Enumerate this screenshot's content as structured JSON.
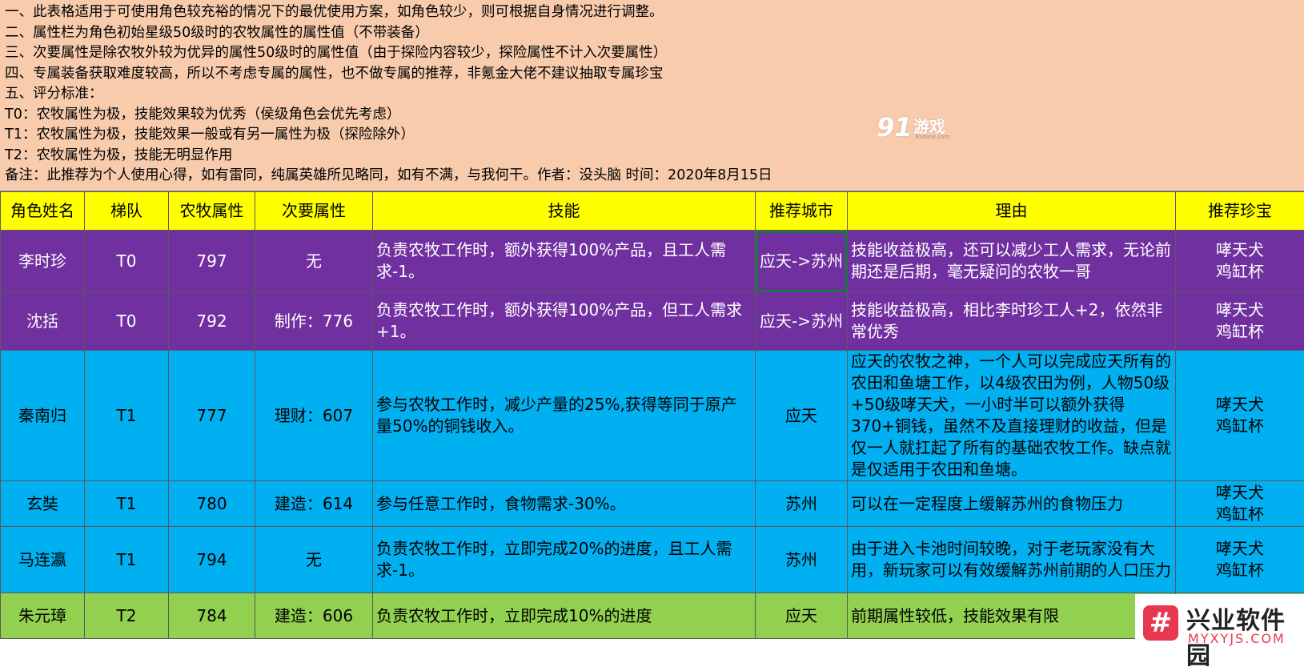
{
  "notes": [
    "一、此表格适用于可使用角色较充裕的情况下的最优使用方案，如角色较少，则可根据自身情况进行调整。",
    "二、属性栏为角色初始星级50级时的农牧属性的属性值（不带装备）",
    "三、次要属性是除农牧外较为优异的属性50级时的属性值（由于探险内容较少，探险属性不计入次要属性）",
    "四、专属装备获取难度较高，所以不考虑专属的属性，也不做专属的推荐，非氪金大佬不建议抽取专属珍宝",
    "五、评分标准：",
    "T0：农牧属性为极，技能效果较为优秀（侯级角色会优先考虑）",
    "T1：农牧属性为极，技能效果一般或有另一属性为极（探险除外）",
    "T2：农牧属性为极，技能无明显作用",
    "备注：此推荐为个人使用心得，如有雷同，纯属英雄所见略同，如有不满，与我何干。作者：没头脑 时间：2020年8月15日"
  ],
  "watermark_91": {
    "num": "91",
    "text": "游戏",
    "url": "91danji.com"
  },
  "headers": [
    "角色姓名",
    "梯队",
    "农牧属性",
    "次要属性",
    "技能",
    "推荐城市",
    "理由",
    "推荐珍宝"
  ],
  "rows": [
    {
      "name": "李时珍",
      "tier": "T0",
      "farm": "797",
      "secondary": "无",
      "skill": "负责农牧工作时，额外获得100%产品，且工人需求-1。",
      "city": "应天->苏州",
      "reason": "技能收益极高，还可以减少工人需求，无论前期还是后期，毫无疑问的农牧一哥",
      "treasure": "哮天犬\n鸡缸杯",
      "color": "#7030a0"
    },
    {
      "name": "沈括",
      "tier": "T0",
      "farm": "792",
      "secondary": "制作：776",
      "skill": "负责农牧工作时，额外获得100%产品，但工人需求+1。",
      "city": "应天->苏州",
      "reason": "技能收益极高，相比李时珍工人+2，依然非常优秀",
      "treasure": "哮天犬\n鸡缸杯",
      "color": "#7030a0"
    },
    {
      "name": "秦南归",
      "tier": "T1",
      "farm": "777",
      "secondary": "理财：607",
      "skill": "参与农牧工作时，减少产量的25%,获得等同于原产量50%的铜钱收入。",
      "city": "应天",
      "reason": "应天的农牧之神，一个人可以完成应天所有的农田和鱼塘工作，以4级农田为例，人物50级+50级哮天犬，一小时半可以额外获得370+铜钱，虽然不及直接理财的收益，但是仅一人就扛起了所有的基础农牧工作。缺点就是仅适用于农田和鱼塘。",
      "treasure": "哮天犬\n鸡缸杯",
      "color": "#00b0f0"
    },
    {
      "name": "玄奘",
      "tier": "T1",
      "farm": "780",
      "secondary": "建造：614",
      "skill": "参与任意工作时，食物需求-30%。",
      "city": "苏州",
      "reason": "可以在一定程度上缓解苏州的食物压力",
      "treasure": "哮天犬\n鸡缸杯",
      "color": "#00b0f0"
    },
    {
      "name": "马连瀛",
      "tier": "T1",
      "farm": "794",
      "secondary": "无",
      "skill": "负责农牧工作时，立即完成20%的进度，且工人需求-1。",
      "city": "苏州",
      "reason": "由于进入卡池时间较晚，对于老玩家没有大用，新玩家可以有效缓解苏州前期的人口压力",
      "treasure": "哮天犬\n鸡缸杯",
      "color": "#00b0f0"
    },
    {
      "name": "朱元璋",
      "tier": "T2",
      "farm": "784",
      "secondary": "建造：606",
      "skill": "负责农牧工作时，立即完成10%的进度",
      "city": "应天",
      "reason": "前期属性较低，技能效果有限",
      "treasure": "",
      "color": "#92d050"
    }
  ],
  "watermark_xy": {
    "logo": "#",
    "name": "兴业软件园",
    "domain": "MYXYJS.COM"
  }
}
